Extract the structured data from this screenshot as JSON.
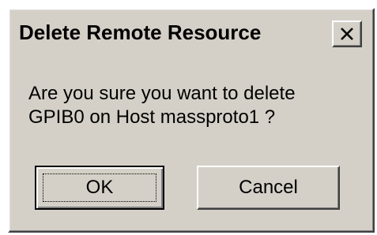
{
  "dialog": {
    "title": "Delete Remote Resource",
    "close_icon": "close-x-icon",
    "message_lines": [
      "Are you sure you want to delete",
      "GPIB0 on Host massproto1 ?"
    ],
    "ok_label": "OK",
    "cancel_label": "Cancel"
  },
  "colors": {
    "face": "#d4d0c8",
    "highlight": "#ffffff",
    "shadow": "#808080",
    "dark_shadow": "#404040",
    "text": "#000000"
  }
}
